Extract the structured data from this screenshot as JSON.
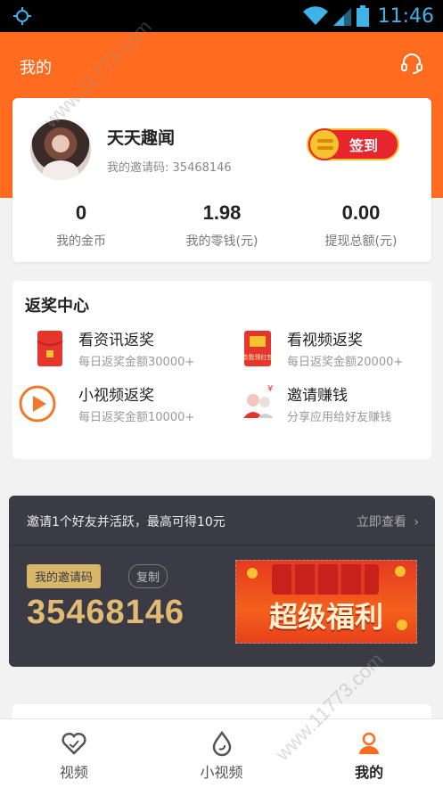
{
  "status_bar": {
    "time": "11:46"
  },
  "header": {
    "title": "我的"
  },
  "profile": {
    "username": "天天趣闻",
    "invite_label": "我的邀请码:",
    "invite_code": "35468146",
    "checkin_label": "签到"
  },
  "stats": [
    {
      "value": "0",
      "label": "我的金币"
    },
    {
      "value": "1.98",
      "label": "我的零钱(元)"
    },
    {
      "value": "0.00",
      "label": "提现总额(元)"
    }
  ],
  "rewards": {
    "title": "返奖中心",
    "items": [
      {
        "title": "看资讯返奖",
        "subtitle": "每日返奖金额30000+",
        "icon": "red-envelope-icon"
      },
      {
        "title": "看视频返奖",
        "subtitle": "每日返奖金额20000+",
        "icon": "video-envelope-icon"
      },
      {
        "title": "小视频返奖",
        "subtitle": "每日返奖金额10000+",
        "icon": "play-icon"
      },
      {
        "title": "邀请赚钱",
        "subtitle": "分享应用给好友赚钱",
        "icon": "invite-friends-icon"
      }
    ],
    "envelope_badge": "点我领红包"
  },
  "invite_banner": {
    "text": "邀请1个好友并活跃，最高可得10元",
    "link": "立即查看",
    "code_tag": "我的邀请码",
    "copy": "复制",
    "code": "35468146",
    "promo": "超级福利"
  },
  "tabs": [
    {
      "label": "视频",
      "icon": "heart-tab-icon",
      "active": false
    },
    {
      "label": "小视频",
      "icon": "drop-tab-icon",
      "active": false
    },
    {
      "label": "我的",
      "icon": "person-tab-icon",
      "active": true
    }
  ],
  "watermark": "www.11773.com",
  "colors": {
    "accent": "#ff6b1f",
    "banner_bg": "#3b3b45",
    "gold": "#e1bb74"
  }
}
